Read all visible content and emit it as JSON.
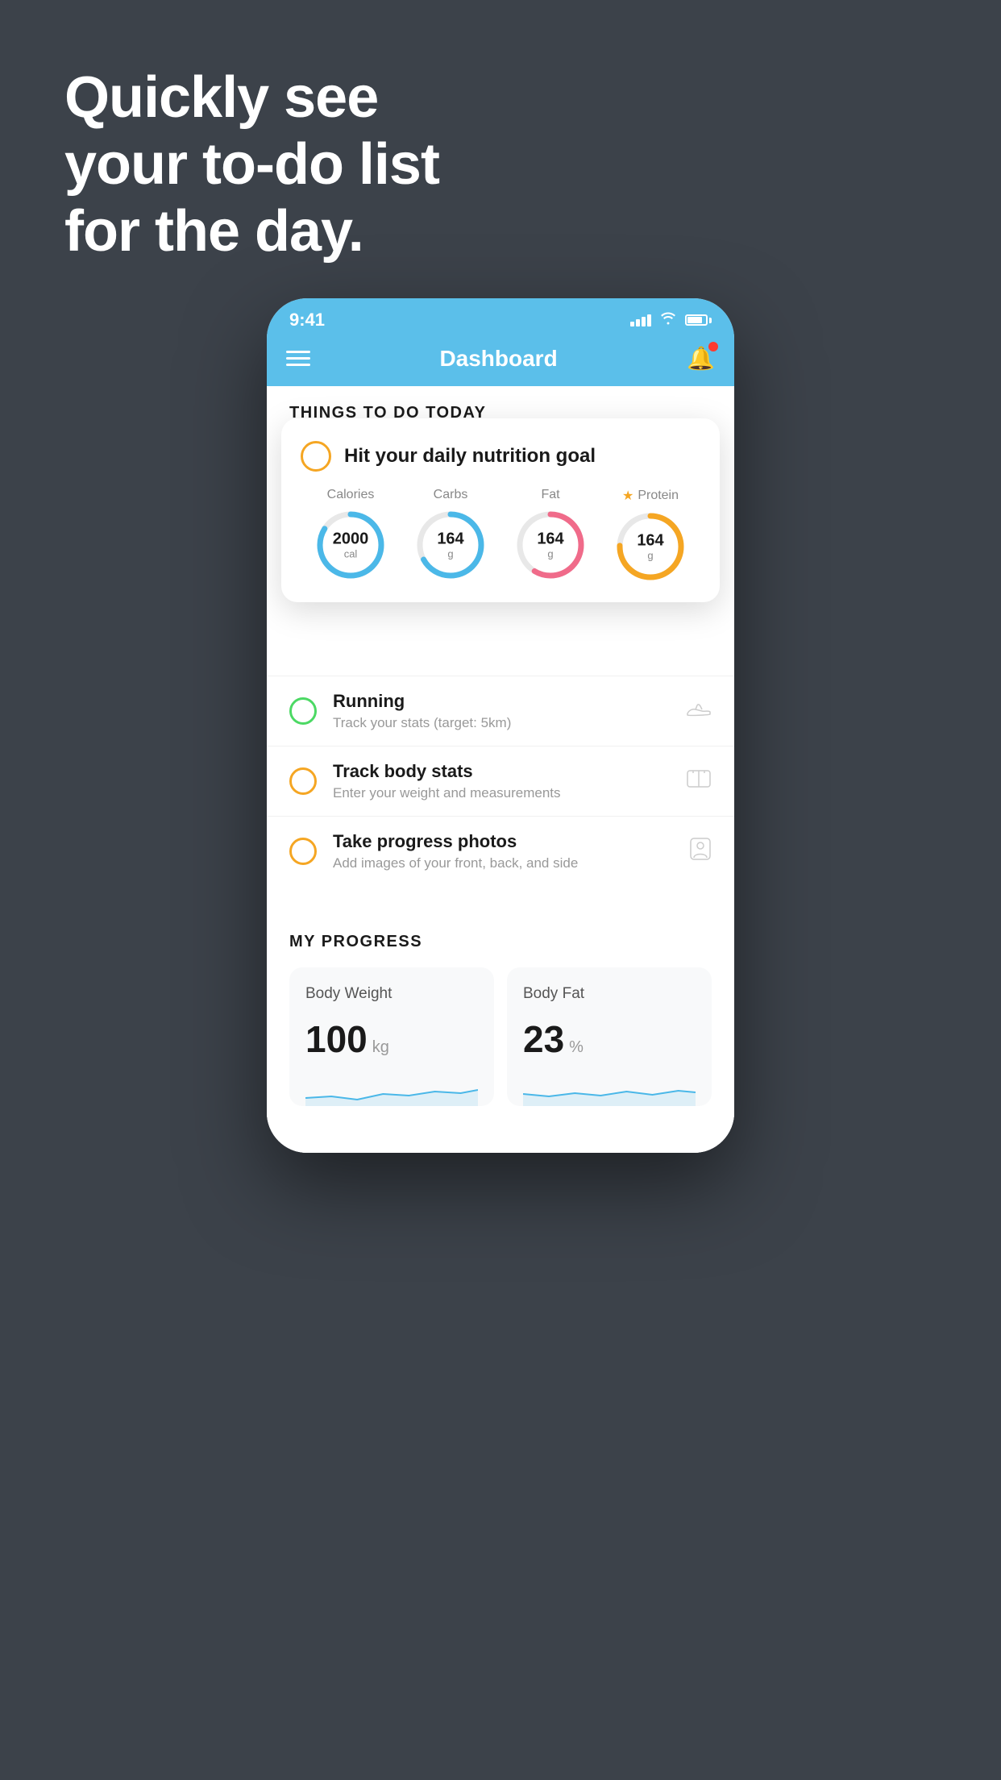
{
  "background": {
    "color": "#3c424a"
  },
  "headline": {
    "line1": "Quickly see",
    "line2": "your to-do list",
    "line3": "for the day."
  },
  "phone": {
    "status_bar": {
      "time": "9:41"
    },
    "nav_bar": {
      "title": "Dashboard"
    },
    "things_today": {
      "header": "THINGS TO DO TODAY",
      "floating_card": {
        "title": "Hit your daily nutrition goal",
        "nutrition": [
          {
            "label": "Calories",
            "value": "2000",
            "unit": "cal",
            "color": "#4bb8e8",
            "highlighted": false
          },
          {
            "label": "Carbs",
            "value": "164",
            "unit": "g",
            "color": "#4bb8e8",
            "highlighted": false
          },
          {
            "label": "Fat",
            "value": "164",
            "unit": "g",
            "color": "#f06b8a",
            "highlighted": false
          },
          {
            "label": "Protein",
            "value": "164",
            "unit": "g",
            "color": "#f5a623",
            "highlighted": true
          }
        ]
      },
      "todo_items": [
        {
          "id": "running",
          "title": "Running",
          "subtitle": "Track your stats (target: 5km)",
          "circle_color": "green",
          "icon": "shoe"
        },
        {
          "id": "track-body-stats",
          "title": "Track body stats",
          "subtitle": "Enter your weight and measurements",
          "circle_color": "yellow",
          "icon": "scale"
        },
        {
          "id": "progress-photos",
          "title": "Take progress photos",
          "subtitle": "Add images of your front, back, and side",
          "circle_color": "yellow",
          "icon": "person"
        }
      ]
    },
    "progress": {
      "header": "MY PROGRESS",
      "cards": [
        {
          "title": "Body Weight",
          "value": "100",
          "unit": "kg"
        },
        {
          "title": "Body Fat",
          "value": "23",
          "unit": "%"
        }
      ]
    }
  }
}
